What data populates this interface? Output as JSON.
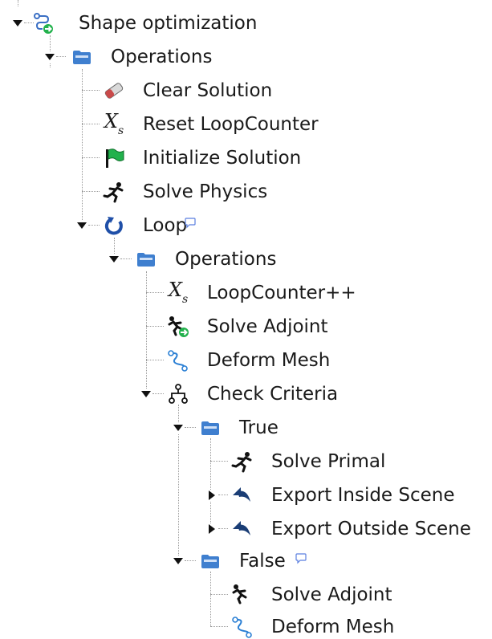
{
  "tree": {
    "root": {
      "label": "Shape optimization",
      "operations": {
        "label": "Operations",
        "clear_solution": "Clear Solution",
        "reset_loopcounter": "Reset LoopCounter",
        "initialize_solution": "Initialize Solution",
        "solve_physics": "Solve Physics",
        "loop": {
          "label": "Loop",
          "has_comment": true,
          "operations": {
            "label": "Operations",
            "loopcounter_increment": "LoopCounter++",
            "solve_adjoint": "Solve Adjoint",
            "deform_mesh": "Deform Mesh",
            "check_criteria": {
              "label": "Check Criteria",
              "true_branch": {
                "label": "True",
                "solve_primal": "Solve Primal",
                "export_inside_scene": "Export Inside Scene",
                "export_outside_scene": "Export Outside Scene"
              },
              "false_branch": {
                "label": "False",
                "has_comment": true,
                "solve_adjoint": "Solve Adjoint",
                "deform_mesh": "Deform Mesh"
              }
            }
          }
        }
      }
    }
  },
  "icons": {
    "folder": "folder-icon",
    "eraser": "eraser-icon",
    "variable": "variable-xs-icon",
    "flag": "green-flag-icon",
    "runner": "running-person-icon",
    "loop": "loop-arrow-icon",
    "adjoint_runner": "adjoint-runner-icon",
    "deform": "deform-mesh-icon",
    "criteria": "branch-criteria-icon",
    "export": "export-arrow-icon",
    "comment": "comment-bubble-icon",
    "workflow": "workflow-icon"
  },
  "colors": {
    "folder": "#3f7fcf",
    "flag": "#22b14c",
    "loop": "#1f4fa8",
    "export": "#1a3d75",
    "comment": "#5b7fe0",
    "text": "#1a1a1a",
    "tree_line": "#9a9a9a"
  },
  "symbols": {
    "variable_base": "X",
    "variable_sub": "s"
  }
}
